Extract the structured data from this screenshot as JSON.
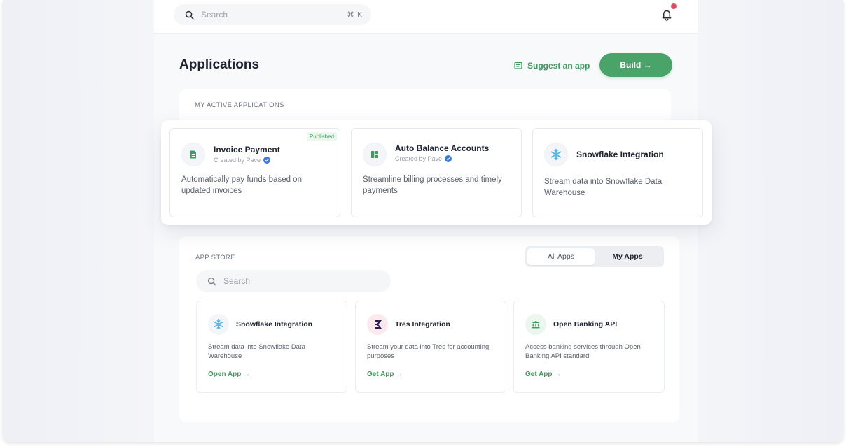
{
  "topbar": {
    "search_placeholder": "Search",
    "shortcut": "⌘ K"
  },
  "header": {
    "title": "Applications",
    "suggest_label": "Suggest an app",
    "build_label": "Build →"
  },
  "active": {
    "section_label": "MY ACTIVE APPLICATIONS",
    "apps": [
      {
        "name": "Invoice Payment",
        "created_by": "Created by Pave",
        "description": "Automatically pay funds based on updated invoices",
        "badge": "Published",
        "icon": "document-icon"
      },
      {
        "name": "Auto Balance Accounts",
        "created_by": "Created by Pave",
        "description": "Streamline billing processes and timely payments",
        "icon": "layout-icon"
      },
      {
        "name": "Snowflake Integration",
        "description": "Stream data into Snowflake Data Warehouse",
        "icon": "snowflake-icon"
      }
    ]
  },
  "store": {
    "section_label": "APP STORE",
    "toggle": {
      "all": "All Apps",
      "mine": "My Apps"
    },
    "search_placeholder": "Search",
    "apps": [
      {
        "name": "Snowflake Integration",
        "description": "Stream data into Snowflake Data Warehouse",
        "link": "Open App →",
        "icon": "snowflake-icon"
      },
      {
        "name": "Tres Integration",
        "description": "Stream your data into Tres for accounting purposes",
        "link": "Get App →",
        "icon": "tres-logo-icon"
      },
      {
        "name": "Open Banking API",
        "description": "Access banking services through Open Banking API standard",
        "link": "Get App →",
        "icon": "bank-icon"
      }
    ]
  },
  "colors": {
    "accent": "#4aa46a",
    "link": "#3f9a5c",
    "notification_dot": "#e14b5f",
    "verified": "#3b7be8"
  }
}
